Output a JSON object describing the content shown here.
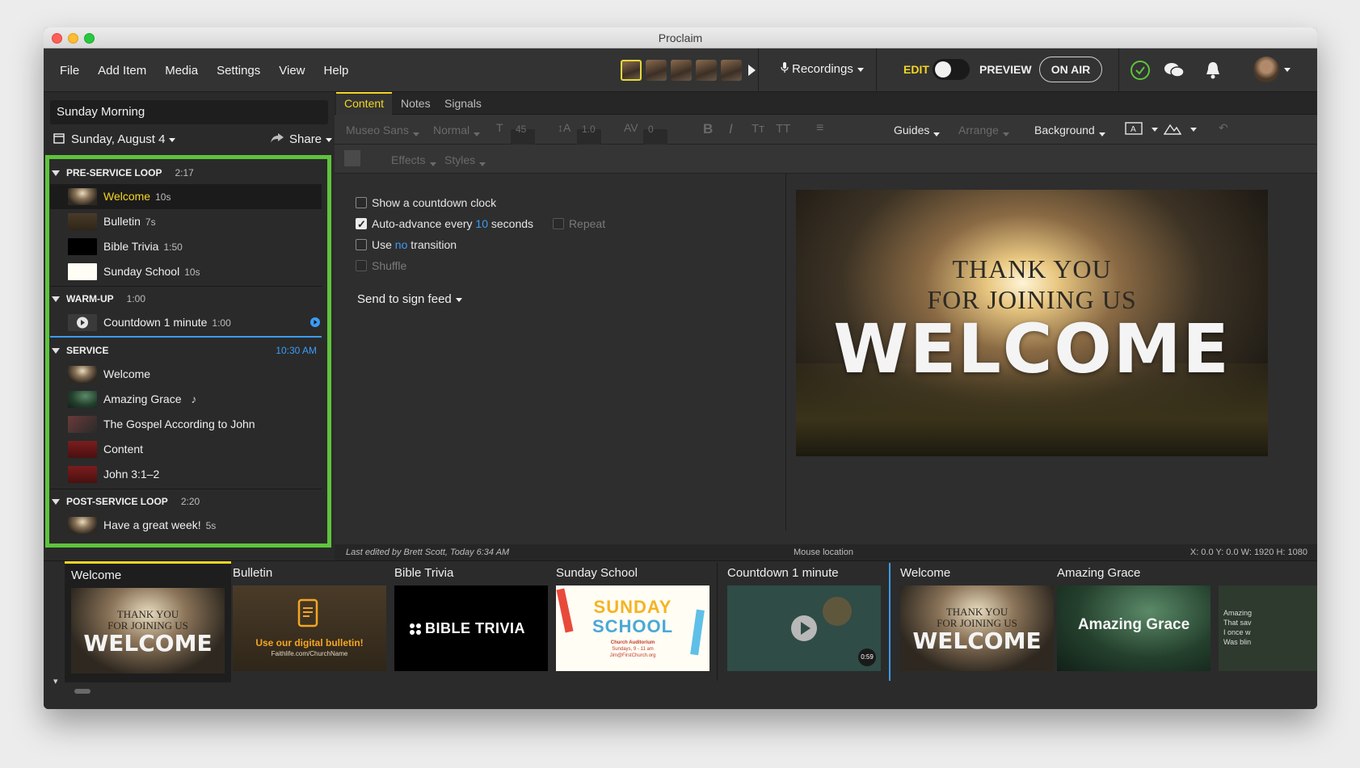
{
  "window": {
    "title": "Proclaim"
  },
  "menu": [
    "File",
    "Add Item",
    "Media",
    "Settings",
    "View",
    "Help"
  ],
  "toolbar": {
    "recordings": "Recordings",
    "edit": "EDIT",
    "preview": "PREVIEW",
    "on_air": "ON AIR"
  },
  "sidebar": {
    "service_name": "Sunday Morning",
    "date": "Sunday, August 4",
    "share": "Share",
    "sections": [
      {
        "title": "PRE-SERVICE LOOP",
        "duration": "2:17",
        "items": [
          {
            "label": "Welcome",
            "duration": "10s"
          },
          {
            "label": "Bulletin",
            "duration": "7s"
          },
          {
            "label": "Bible Trivia",
            "duration": "1:50"
          },
          {
            "label": "Sunday School",
            "duration": "10s"
          }
        ]
      },
      {
        "title": "WARM-UP",
        "duration": "1:00",
        "items": [
          {
            "label": "Countdown 1 minute",
            "duration": "1:00"
          }
        ]
      },
      {
        "title": "SERVICE",
        "time": "10:30 AM",
        "items": [
          {
            "label": "Welcome"
          },
          {
            "label": "Amazing Grace",
            "note": "♪"
          },
          {
            "label": "The Gospel According to John"
          },
          {
            "label": "Content"
          },
          {
            "label": "John 3:1–2"
          }
        ]
      },
      {
        "title": "POST-SERVICE LOOP",
        "duration": "2:20",
        "items": [
          {
            "label": "Have a great week!",
            "duration": "5s"
          }
        ]
      }
    ]
  },
  "editor": {
    "tabs": [
      "Content",
      "Notes",
      "Signals"
    ],
    "font": "Museo Sans",
    "weight": "Normal",
    "size": "45",
    "line_height": "1.0",
    "spacing": "0",
    "guides": "Guides",
    "arrange": "Arrange",
    "background": "Background",
    "effects": "Effects",
    "styles": "Styles",
    "options": {
      "countdown_a": "Show a",
      "countdown_b": "countdown clock",
      "advance_a": "Auto-advance every",
      "advance_value": "10",
      "advance_b": "seconds",
      "repeat": "Repeat",
      "transition_a": "Use",
      "transition_value": "no",
      "transition_b": "transition",
      "shuffle": "Shuffle"
    },
    "send_to": "Send to sign feed"
  },
  "slide": {
    "line1": "THANK YOU",
    "line2": "FOR JOINING US",
    "big": "WELCOME"
  },
  "status": {
    "last_edited": "Last edited by Brett Scott, Today 6:34 AM",
    "mouse": "Mouse location",
    "coords": "X: 0.0  Y: 0.0    W: 1920  H: 1080"
  },
  "filmstrip": {
    "items": [
      {
        "title": "Welcome"
      },
      {
        "title": "Bulletin",
        "text": "Use our digital bulletin!",
        "sub": "Faithlife.com/ChurchName"
      },
      {
        "title": "Bible Trivia",
        "text": "BIBLE TRIVIA"
      },
      {
        "title": "Sunday School",
        "text1": "SUNDAY",
        "text2": "SCHOOL",
        "sub1": "Church Auditorium",
        "sub2": "Sundays, 9 - 11 am",
        "sub3": "Jim@FirstChurch.org"
      },
      {
        "title": "Countdown 1 minute",
        "timer": "0:59"
      },
      {
        "title": "Welcome"
      },
      {
        "title": "Amazing Grace",
        "text": "Amazing Grace"
      }
    ],
    "partial_text": "Amazing\nThat sav\nI once w\nWas blin"
  },
  "colors": {
    "accent_yellow": "#f5d524",
    "accent_blue": "#3b9cf5",
    "highlight_green": "#5ec43c"
  }
}
